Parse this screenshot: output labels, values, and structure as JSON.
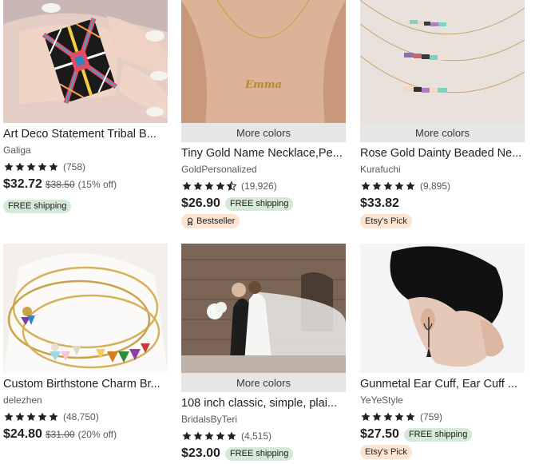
{
  "listings": [
    {
      "title": "Art Deco Statement Tribal B...",
      "shop": "Galiga",
      "rating_count": "(758)",
      "stars": 5,
      "price": "$32.72",
      "original_price": "$38.50",
      "discount": "(15% off)",
      "shipping_badge": "FREE shipping"
    },
    {
      "more_colors": "More colors",
      "title": "Tiny Gold Name Necklace,Pe...",
      "shop": "GoldPersonalized",
      "rating_count": "(19,926)",
      "stars": 4.5,
      "price": "$26.90",
      "shipping_badge": "FREE shipping",
      "tag": "Bestseller"
    },
    {
      "more_colors": "More colors",
      "title": "Rose Gold Dainty Beaded Ne...",
      "shop": "Kurafuchi",
      "rating_count": "(9,895)",
      "stars": 5,
      "price": "$33.82",
      "tag": "Etsy's Pick"
    },
    {
      "title": "Custom Birthstone Charm Br...",
      "shop": "delezhen",
      "rating_count": "(48,750)",
      "stars": 5,
      "price": "$24.80",
      "original_price": "$31.00",
      "discount": "(20% off)"
    },
    {
      "more_colors": "More colors",
      "title": "108 inch classic, simple, plai...",
      "shop": "BridalsByTeri",
      "rating_count": "(4,515)",
      "stars": 5,
      "price": "$23.00",
      "shipping_badge": "FREE shipping"
    },
    {
      "title": "Gunmetal Ear Cuff, Ear Cuff ...",
      "shop": "YeYeStyle",
      "rating_count": "(759)",
      "stars": 5,
      "price": "$27.50",
      "shipping_badge": "FREE shipping",
      "tag": "Etsy's Pick"
    }
  ],
  "colors": {
    "star": "#222222",
    "shipping_badge_bg": "#d4e9d7",
    "tag_bg": "#fce3d2",
    "more_colors_bg": "#e6e6e4"
  },
  "icons": {
    "star": "star-icon",
    "half_star": "half-star-icon",
    "bestseller": "award-icon"
  }
}
